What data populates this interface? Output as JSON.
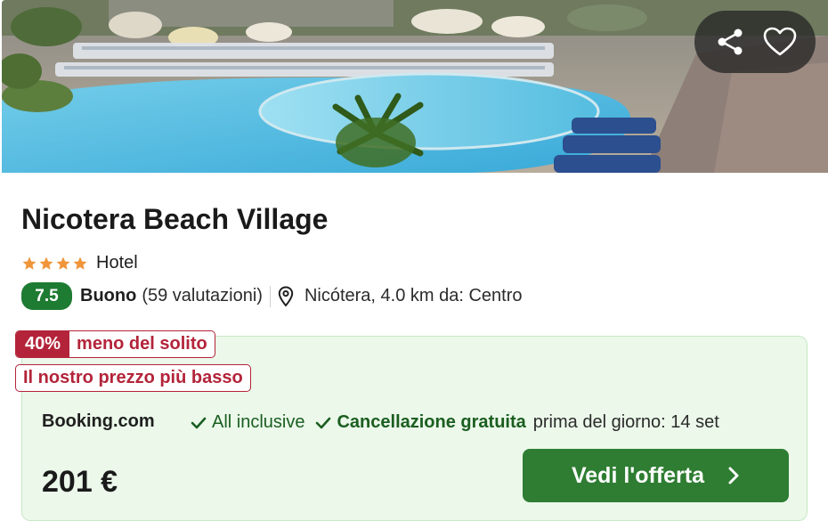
{
  "hotel": {
    "name": "Nicotera Beach Village",
    "star_rating": 4,
    "type": "Hotel",
    "score": "7.5",
    "score_label": "Buono",
    "reviews": "(59 valutazioni)",
    "location": "Nicótera, 4.0 km da: Centro"
  },
  "image": {
    "description_icon": "pool-photo",
    "actions": [
      "share-icon",
      "heart-icon"
    ]
  },
  "offer": {
    "discount_pct": "40%",
    "discount_text": "meno del solito",
    "lowest_price_text": "Il nostro prezzo più basso",
    "provider": "Booking.com",
    "feature_1": "All inclusive",
    "feature_2": "Cancellazione gratuita",
    "feature_2_detail": "prima del giorno: 14 set",
    "price": "201 €",
    "cta_label": "Vedi l'offerta"
  },
  "colors": {
    "score_bg": "#1e7b32",
    "cta_bg": "#2e7d32",
    "offer_bg": "#ebf8ea",
    "discount": "#b3243a",
    "star": "#f0953a"
  }
}
